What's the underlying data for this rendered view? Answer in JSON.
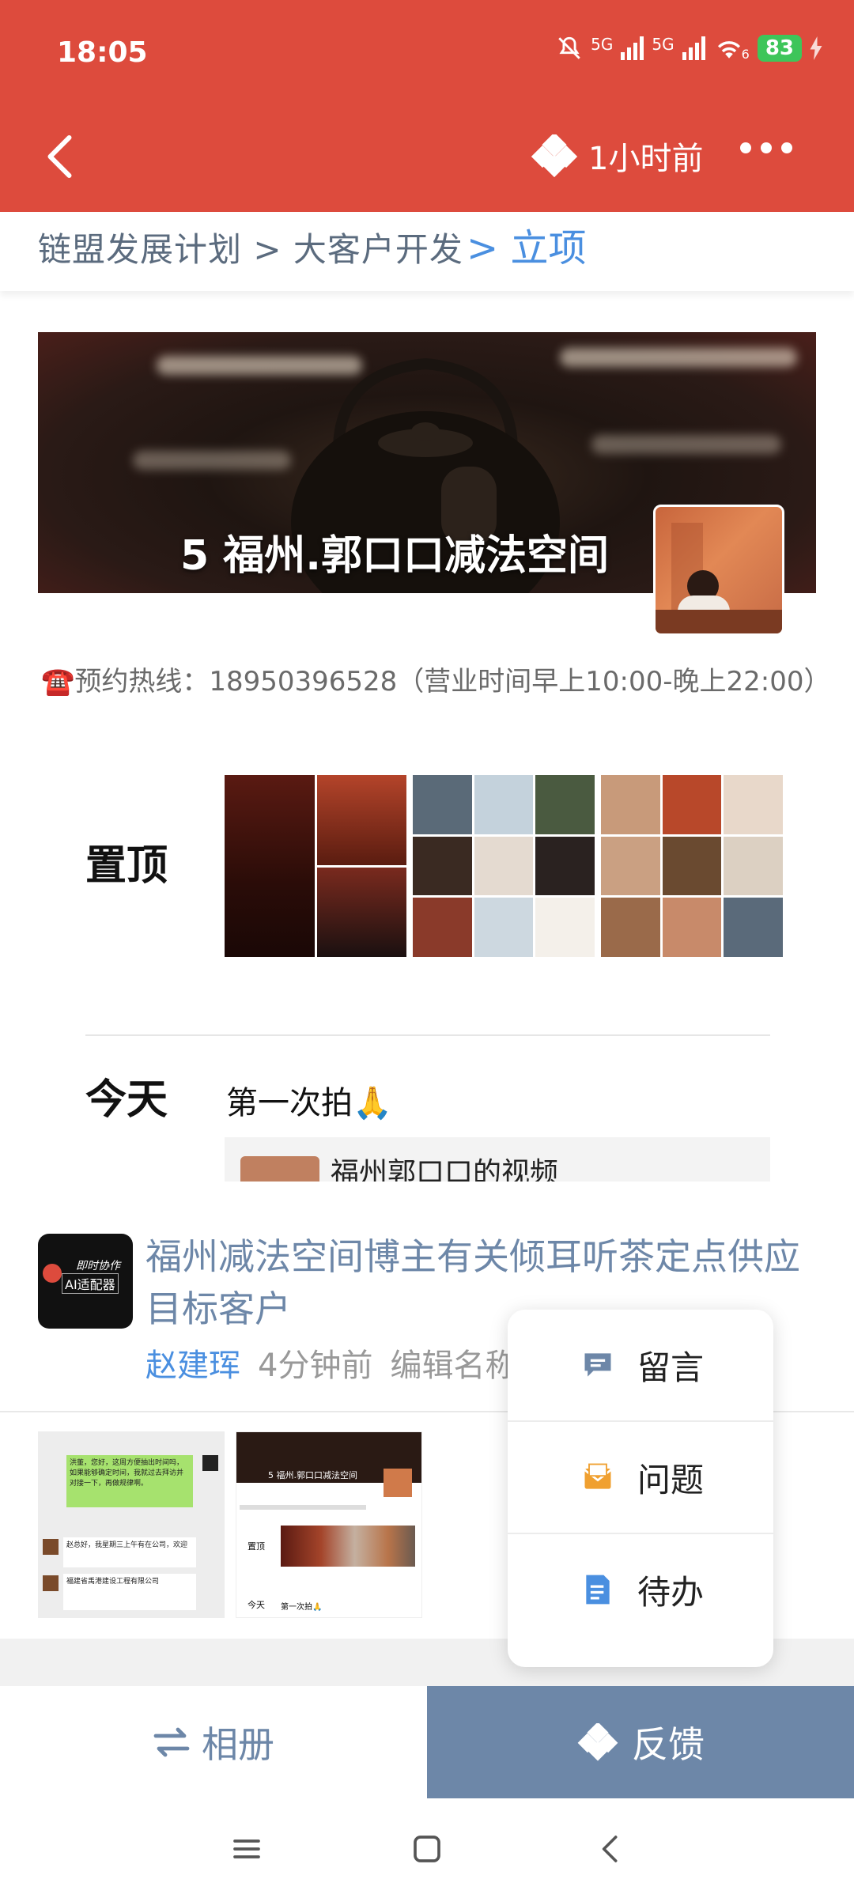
{
  "status_bar": {
    "time": "18:05",
    "signal_1_label": "5G",
    "signal_2_label": "5G",
    "wifi_label": "6",
    "battery": "83",
    "icons": [
      "mute-bell-icon",
      "signal-icon",
      "signal-icon",
      "wifi-icon",
      "battery-icon",
      "charging-icon"
    ]
  },
  "header": {
    "back_icon": "chevron-left-icon",
    "logo_icon": "diamond-logo-icon",
    "time_ago": "1小时前",
    "more_icon": "more-dots-icon",
    "background_color": "#dd4b3d"
  },
  "breadcrumb": {
    "path": "链盟发展计划 > 大客户开发",
    "current": "> 立项"
  },
  "banner": {
    "title": "5 福州.郭口口减法空间"
  },
  "hotline": "☎️预约热线：18950396528（营业时间早上10:00-晚上22:00）",
  "pinned": {
    "label": "置顶"
  },
  "today": {
    "label": "今天",
    "text": "第一次拍🙏",
    "video_title": "福州郭口口的视频"
  },
  "card": {
    "app_icon_line1": "即时协作",
    "app_icon_line2": "AI适配器",
    "title": "福州减法空间博主有关倾耳听茶定点供应目标客户",
    "author": "赵建珲",
    "time": "4分钟前",
    "action": "编辑名称"
  },
  "thumbnails": {
    "shot1_msg1": "洪董，您好，这周方便抽出时间吗，如果能够确定时间，我就过去拜访并对接一下，再做规律啊。",
    "shot1_msg2": "赵总好，我星期三上午有在公司，欢迎",
    "shot1_msg3": "福建省禹港建设工程有限公司",
    "shot2_title": "5 福州.郭口口减法空间",
    "shot2_pinned": "置顶",
    "shot2_today": "今天",
    "shot2_text": "第一次拍🙏"
  },
  "popup": {
    "items": [
      {
        "label": "留言",
        "icon": "message-icon"
      },
      {
        "label": "问题",
        "icon": "question-mail-icon"
      },
      {
        "label": "待办",
        "icon": "todo-doc-icon"
      }
    ]
  },
  "bottom_bar": {
    "album_label": "相册",
    "album_icon": "swap-arrows-icon",
    "feedback_label": "反馈",
    "feedback_icon": "diamond-logo-icon",
    "feedback_color": "#6d87a8"
  },
  "nav": {
    "icons": [
      "menu-icon",
      "home-square-icon",
      "back-icon"
    ]
  }
}
